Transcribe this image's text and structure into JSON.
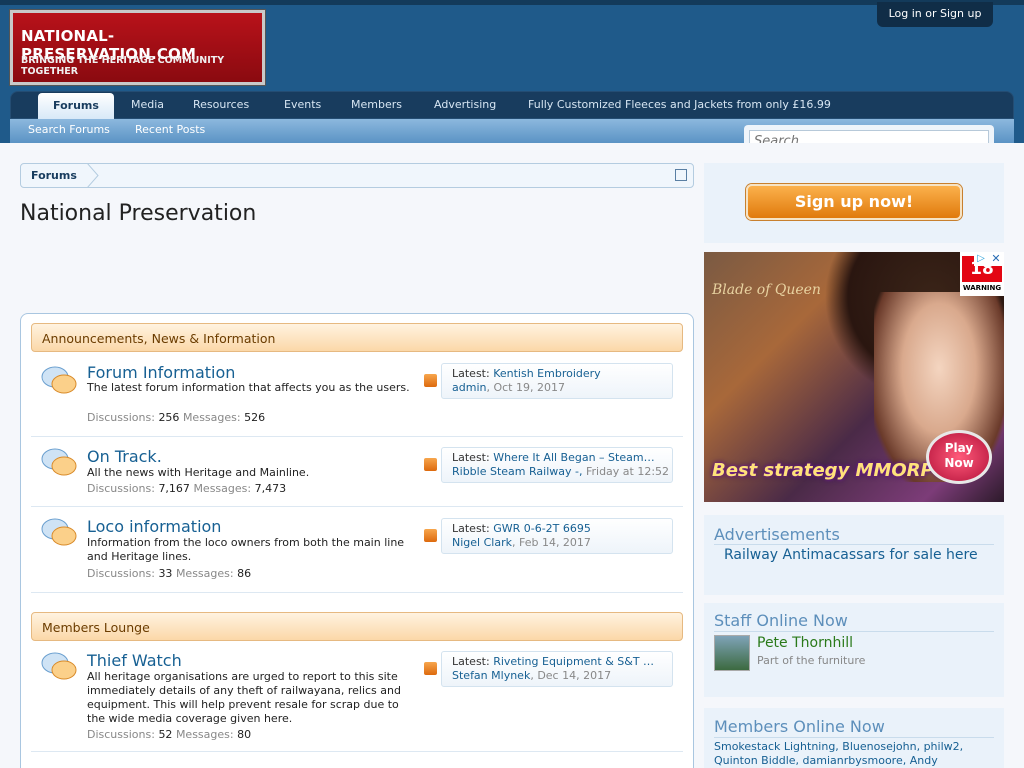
{
  "header": {
    "logo_title": "NATIONAL-PRESERVATION.COM",
    "logo_tagline": "BRINGING THE HERITAGE COMMUNITY TOGETHER",
    "login_label": "Log in or Sign up"
  },
  "nav": {
    "tabs": [
      "Forums",
      "Media",
      "Resources",
      "Events",
      "Members",
      "Advertising",
      "Fully Customized Fleeces and Jackets from only £16.99"
    ],
    "sub_links": [
      "Search Forums",
      "Recent Posts"
    ],
    "search_placeholder": "Search..."
  },
  "breadcrumb": {
    "item": "Forums"
  },
  "page_title": "National Preservation",
  "categories": [
    {
      "title": "Announcements, News & Information"
    },
    {
      "title": "Members Lounge"
    }
  ],
  "labels": {
    "discussions": "Discussions:",
    "messages": "Messages:",
    "latest": "Latest:"
  },
  "nodes": [
    {
      "title": "Forum Information",
      "desc": "The latest forum information that affects you as the users.",
      "discussions": "256",
      "messages": "526",
      "latest_title": "Kentish Embroidery",
      "latest_user": "admin",
      "latest_date": "Oct 19, 2017"
    },
    {
      "title": "On Track.",
      "desc": "All the news with Heritage and Mainline.",
      "discussions": "7,167",
      "messages": "7,473",
      "latest_title": "Where It All Began – Steam…",
      "latest_user": "Ribble Steam Railway -,",
      "latest_date": "Friday at 12:52"
    },
    {
      "title": "Loco information",
      "desc": "Information from the loco owners from both the main line and Heritage lines.",
      "discussions": "33",
      "messages": "86",
      "latest_title": "GWR 0-6-2T 6695",
      "latest_user": "Nigel Clark",
      "latest_date": "Feb 14, 2017"
    },
    {
      "title": "Thief Watch",
      "desc": "All heritage organisations are urged to report to this site immediately details of any theft of railwayana, relics and equipment. This will help prevent resale for scrap due to the wide media coverage given here.",
      "discussions": "52",
      "messages": "80",
      "latest_title": "Riveting Equipment & S&T …",
      "latest_user": "Stefan Mlynek",
      "latest_date": "Dec 14, 2017"
    }
  ],
  "sidebar": {
    "signup_label": "Sign up now!",
    "ad": {
      "logo_text": "Blade of Queen",
      "tagline": "Best strategy MMORPG",
      "play_label": "Play Now",
      "age_rating": "18",
      "age_warning": "WARNING",
      "close_glyph": "✕",
      "choices_glyph": "▷"
    },
    "advertisements_title": "Advertisements",
    "advertisements_link": "Railway Antimacassars for sale here",
    "staff_title": "Staff Online Now",
    "staff_name": "Pete Thornhill",
    "staff_role": "Part of the furniture",
    "members_title": "Members Online Now",
    "members_list": "Smokestack Lightning, Bluenosejohn, philw2, Quinton Biddle, damianrbysmoore, Andy"
  },
  "colors": {
    "header": "#1f5a8a",
    "nav": "#183c5e",
    "link": "#176093",
    "accent": "#e07a0c"
  }
}
